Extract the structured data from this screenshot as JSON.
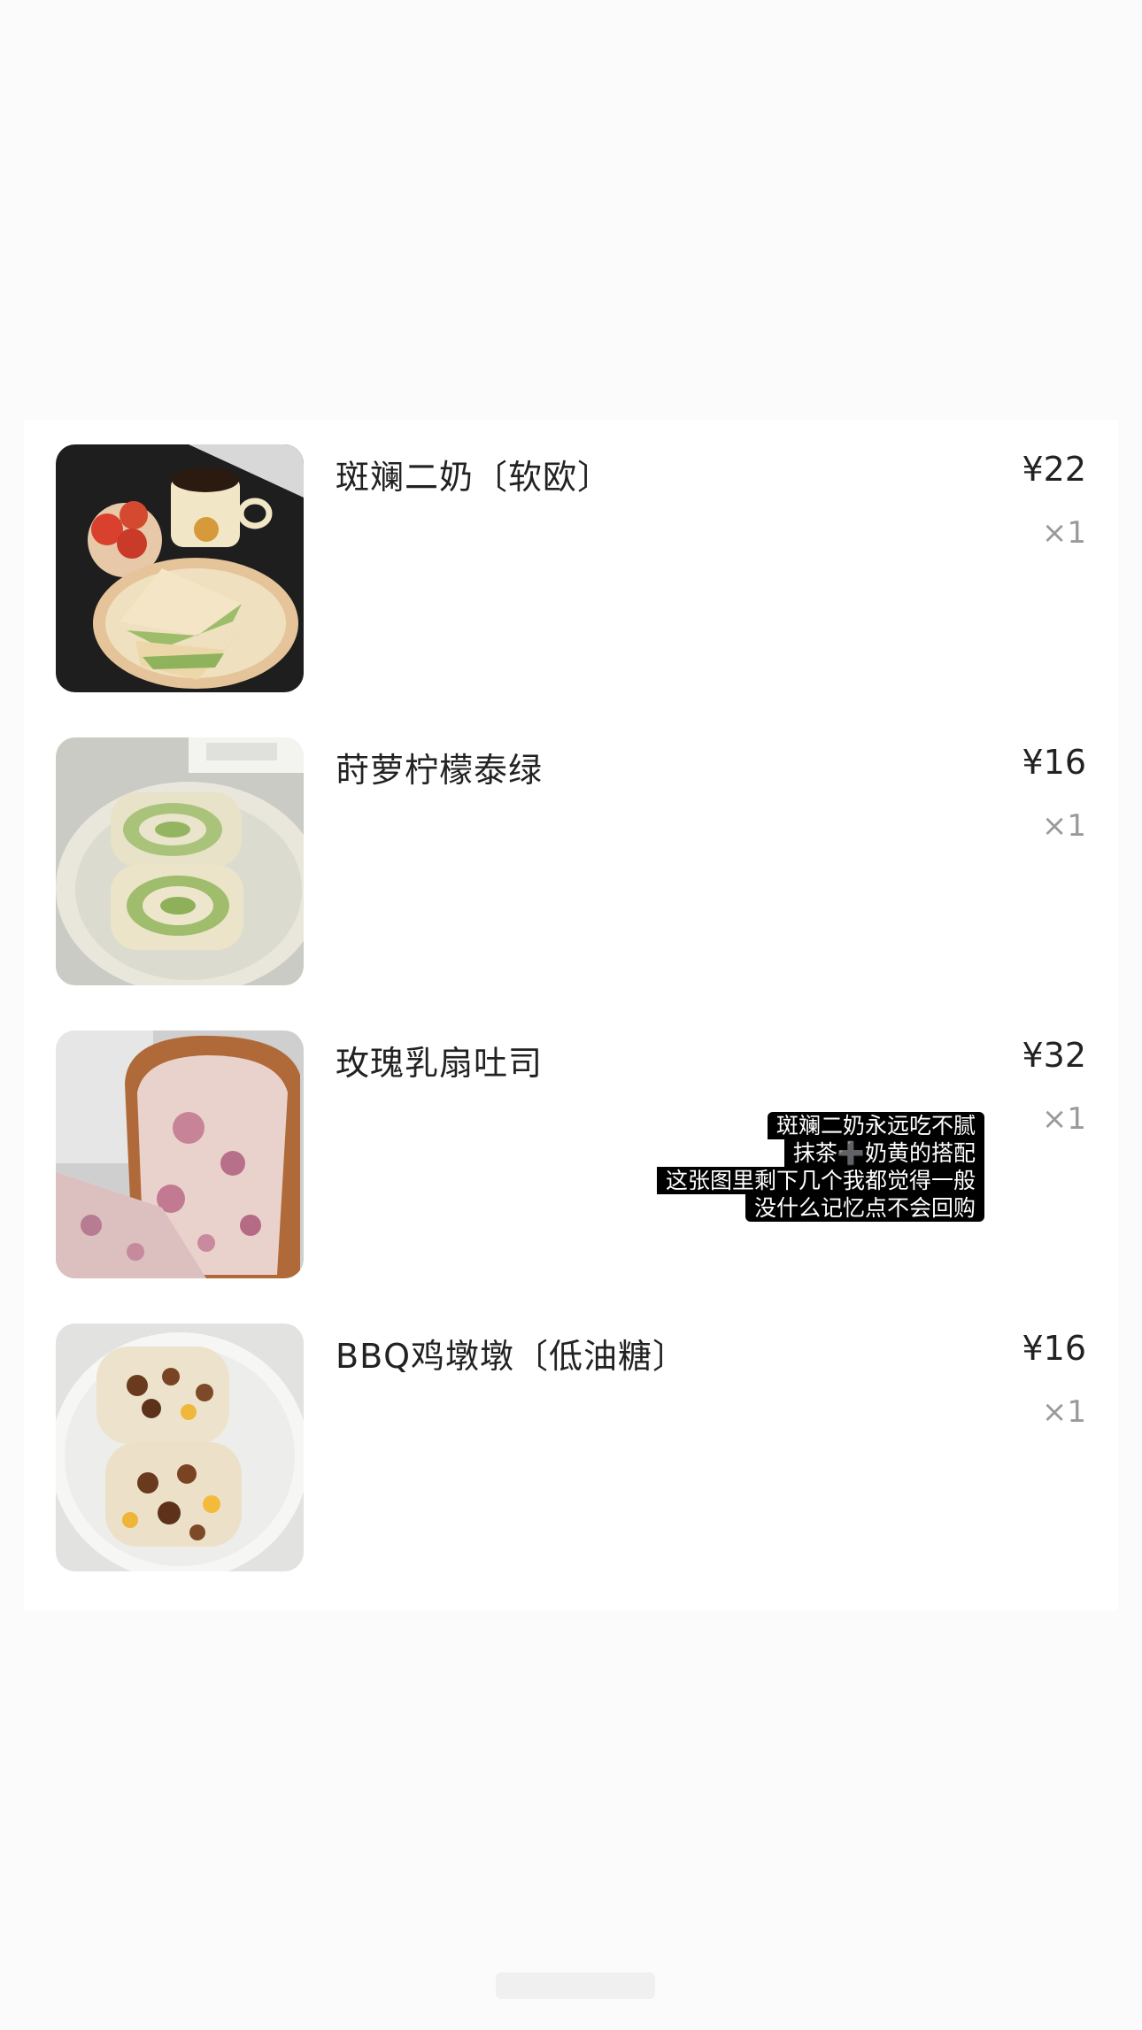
{
  "order": {
    "items": [
      {
        "name": "斑斓二奶〔软欧〕",
        "price": "¥22",
        "quantity": "×1",
        "image": "bread-with-coffee-photo"
      },
      {
        "name": "莳萝柠檬泰绿",
        "price": "¥16",
        "quantity": "×1",
        "image": "matcha-swirl-bread-photo"
      },
      {
        "name": "玫瑰乳扇吐司",
        "price": "¥32",
        "quantity": "×1",
        "image": "rose-toast-photo"
      },
      {
        "name": "BBQ鸡墩墩〔低油糖〕",
        "price": "¥16",
        "quantity": "×1",
        "image": "bbq-chicken-bread-photo"
      }
    ]
  },
  "caption": {
    "lines": [
      "斑斓二奶永远吃不腻",
      "抹茶➕奶黄的搭配",
      "这张图里剩下几个我都觉得一般",
      "没什么记忆点不会回购"
    ]
  },
  "colors": {
    "background": "#fbfbfb",
    "card": "#ffffff",
    "text": "#222222",
    "muted": "#9a9a9a",
    "caption_bg": "#000000"
  }
}
